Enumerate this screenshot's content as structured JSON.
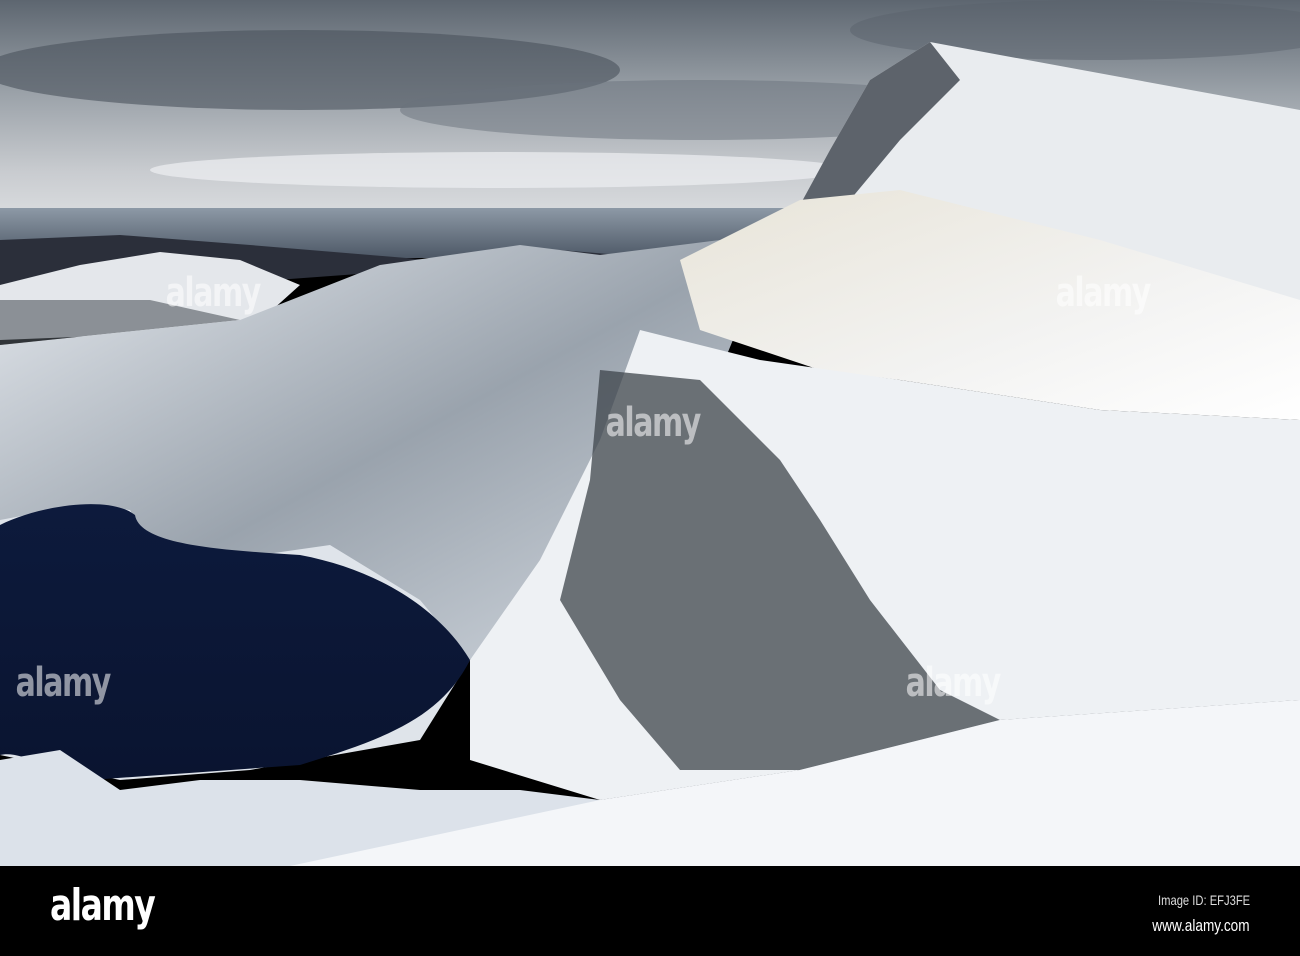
{
  "photo": {
    "subject": "snow-covered mountain ridge above a dark lake"
  },
  "watermark": {
    "text": "alamy"
  },
  "footer": {
    "logo": "alamy",
    "image_id": "Image ID: EFJ3FE",
    "url": "www.alamy.com"
  }
}
